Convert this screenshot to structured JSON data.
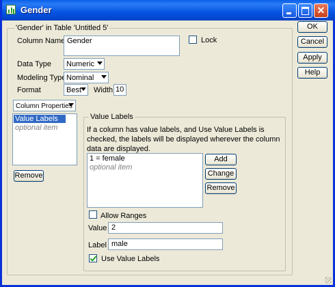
{
  "window": {
    "title": "Gender"
  },
  "column_group": {
    "legend": "'Gender' in Table 'Untitled 5'"
  },
  "column_name": {
    "label": "Column Name",
    "value": "Gender"
  },
  "lock": {
    "label": "Lock",
    "checked": false
  },
  "data_type": {
    "label": "Data Type",
    "value": "Numeric"
  },
  "modeling_type": {
    "label": "Modeling Type",
    "value": "Nominal"
  },
  "format": {
    "label": "Format",
    "value": "Best",
    "width_label": "Width",
    "width_value": "10"
  },
  "column_properties": {
    "label": "Column Properties"
  },
  "properties_list": {
    "items": [
      "Value Labels",
      "optional item"
    ]
  },
  "remove_left": "Remove",
  "value_labels": {
    "legend": "Value Labels",
    "description": "If a column has value labels, and Use Value Labels is checked, the labels will be displayed wherever the column data are displayed.",
    "list_items": [
      "1 = female",
      "optional item"
    ],
    "add": "Add",
    "change": "Change",
    "remove": "Remove",
    "allow_ranges": "Allow Ranges",
    "value_label": "Value",
    "value": "2",
    "label_label": "Label",
    "label_value": "male",
    "use_value_labels": "Use Value Labels"
  },
  "buttons": {
    "ok": "OK",
    "cancel": "Cancel",
    "apply": "Apply",
    "help": "Help"
  }
}
